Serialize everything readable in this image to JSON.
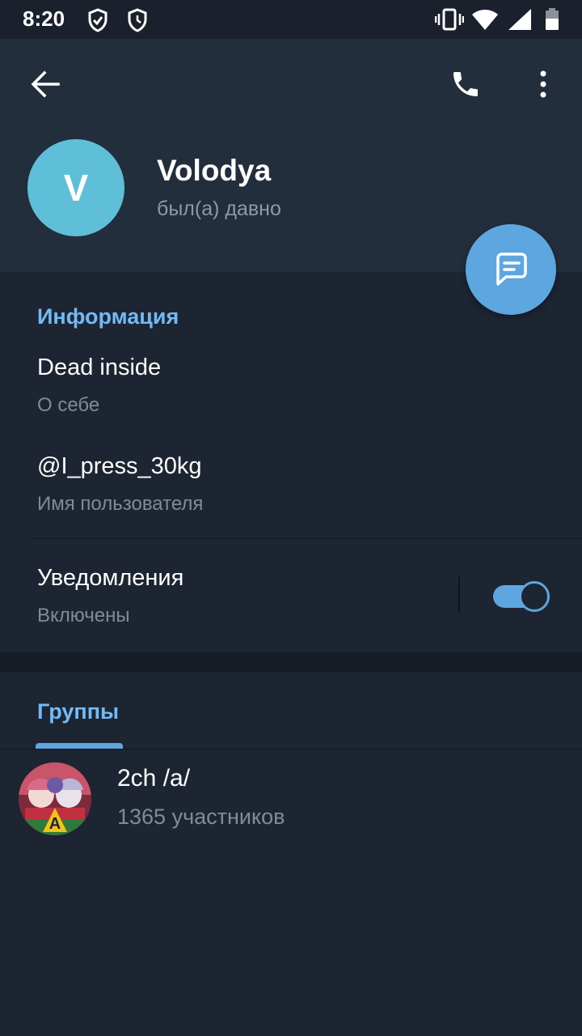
{
  "status_bar": {
    "time": "8:20"
  },
  "profile": {
    "avatar_letter": "V",
    "name": "Volodya",
    "last_seen": "был(а) давно"
  },
  "info": {
    "title": "Информация",
    "bio": "Dead inside",
    "bio_label": "О себе",
    "username": "@I_press_30kg",
    "username_label": "Имя пользователя",
    "notifications": "Уведомления",
    "notifications_state": "Включены",
    "notifications_on": true
  },
  "groups": {
    "tab_label": "Группы",
    "items": [
      {
        "name": "2ch /a/",
        "members": "1365 участников"
      }
    ]
  },
  "colors": {
    "accent": "#5da6e0",
    "accent_text": "#71baf3",
    "background": "#1d2533",
    "header": "#232e3c",
    "avatar": "#5fbed8"
  }
}
